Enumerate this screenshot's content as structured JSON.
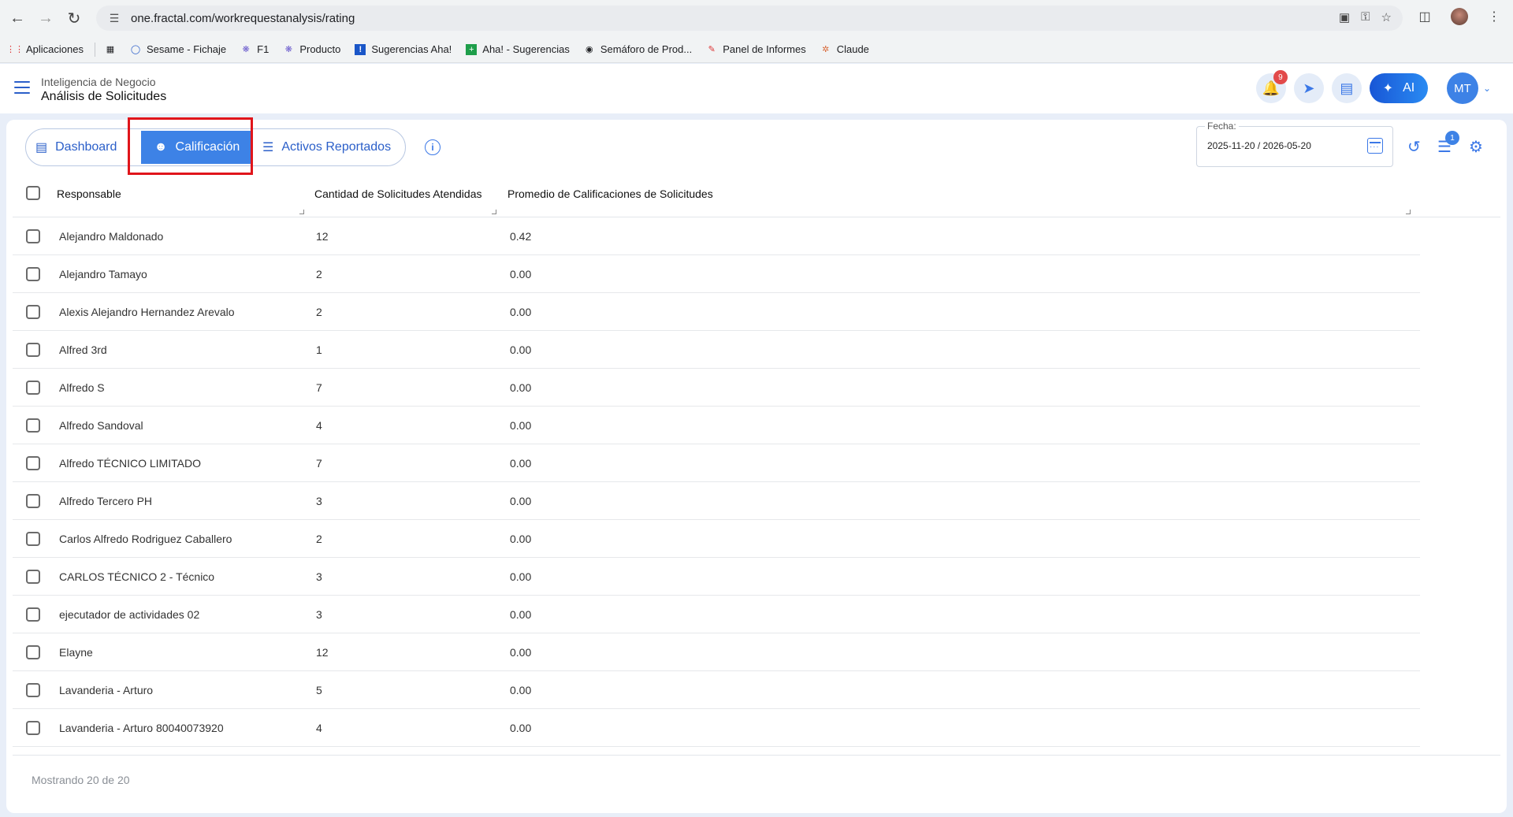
{
  "browser": {
    "url": "one.fractal.com/workrequestanalysis/rating",
    "bookmarks": [
      {
        "label": "Aplicaciones",
        "icon": "apps-grid-icon"
      },
      {
        "label": "",
        "icon": "grid-icon"
      },
      {
        "label": "Sesame - Fichaje",
        "icon": "sesame-icon"
      },
      {
        "label": "F1",
        "icon": "fractal-icon"
      },
      {
        "label": "Producto",
        "icon": "fractal-icon"
      },
      {
        "label": "Sugerencias Aha!",
        "icon": "aha-icon"
      },
      {
        "label": "Aha! - Sugerencias",
        "icon": "sheets-icon"
      },
      {
        "label": "Semáforo de Prod...",
        "icon": "traffic-light-icon"
      },
      {
        "label": "Panel de Informes",
        "icon": "report-icon"
      },
      {
        "label": "Claude",
        "icon": "claude-icon"
      }
    ]
  },
  "header": {
    "section": "Inteligencia de Negocio",
    "title": "Análisis de Solicitudes",
    "notifications_count": "9",
    "ai_label": "AI",
    "avatar_initials": "MT"
  },
  "tabs": [
    {
      "label": "Dashboard",
      "active": false
    },
    {
      "label": "Calificación",
      "active": true
    },
    {
      "label": "Activos Reportados",
      "active": false
    }
  ],
  "filters": {
    "date_label": "Fecha:",
    "date_value": "2025-11-20 / 2026-05-20",
    "filter_count": "1"
  },
  "table": {
    "columns": [
      "Responsable",
      "Cantidad de Solicitudes Atendidas",
      "Promedio de Calificaciones de Solicitudes"
    ],
    "rows": [
      [
        "Alejandro Maldonado",
        "12",
        "0.42"
      ],
      [
        "Alejandro Tamayo",
        "2",
        "0.00"
      ],
      [
        "Alexis Alejandro Hernandez Arevalo",
        "2",
        "0.00"
      ],
      [
        "Alfred 3rd",
        "1",
        "0.00"
      ],
      [
        "Alfredo S",
        "7",
        "0.00"
      ],
      [
        "Alfredo Sandoval",
        "4",
        "0.00"
      ],
      [
        "Alfredo TÉCNICO LIMITADO",
        "7",
        "0.00"
      ],
      [
        "Alfredo Tercero PH",
        "3",
        "0.00"
      ],
      [
        "Carlos Alfredo Rodriguez Caballero",
        "2",
        "0.00"
      ],
      [
        "CARLOS TÉCNICO 2 - Técnico",
        "3",
        "0.00"
      ],
      [
        "ejecutador de actividades 02",
        "3",
        "0.00"
      ],
      [
        "Elayne",
        "12",
        "0.00"
      ],
      [
        "Lavanderia - Arturo",
        "5",
        "0.00"
      ],
      [
        "Lavanderia - Arturo 80040073920",
        "4",
        "0.00"
      ]
    ],
    "footer": "Mostrando 20 de 20"
  },
  "colors": {
    "accent": "#3d82e6",
    "highlight": "#e0151b"
  }
}
